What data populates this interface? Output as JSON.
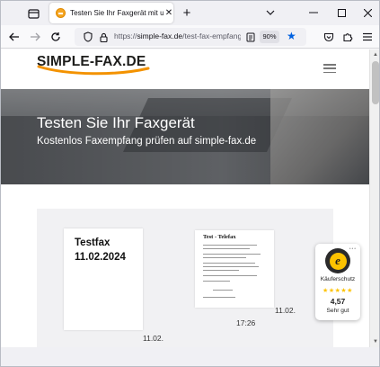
{
  "browser": {
    "tab": {
      "title": "Testen Sie Ihr Faxgerät mit uns",
      "close_symbol": "✕"
    },
    "newtab_symbol": "+",
    "window_controls": {
      "minimize": "—",
      "maximize": "☐",
      "close": "✕"
    },
    "url": {
      "prefix": "https://",
      "host": "simple-fax.de",
      "path": "/test-fax-empfang",
      "zoom": "90%"
    },
    "icons": {
      "tabs_menu": "tab-list-icon",
      "back": "arrow-left-icon",
      "forward": "arrow-right-icon",
      "reload": "reload-icon",
      "shield": "shield-icon",
      "lock": "lock-icon",
      "reader": "reader-view-icon",
      "bookmark": "star-icon",
      "pocket": "pocket-icon",
      "extensions": "puzzle-icon",
      "menu": "hamburger-menu-icon"
    }
  },
  "site": {
    "logo_text": "SIMPLE-FAX.DE",
    "hero": {
      "title": "Testen Sie Ihr Faxgerät",
      "subtitle": "Kostenlos Faxempfang prüfen auf simple-fax.de"
    },
    "gallery": {
      "card1": {
        "line1": "Testfax",
        "line2": "11.02.2024"
      },
      "card2": {
        "title": "Test - Telefax"
      },
      "captions": {
        "date_a": "11.02.",
        "time": "17:26",
        "date_b": "11.02."
      }
    },
    "trust_badge": {
      "label": "Käuferschutz",
      "stars": "★★★★★",
      "score": "4,57",
      "rating": "Sehr gut",
      "seal_letter": "e"
    }
  },
  "colors": {
    "accent_blue": "#0061e0",
    "logo_orange": "#f39200",
    "trust_yellow": "#fdc300"
  }
}
